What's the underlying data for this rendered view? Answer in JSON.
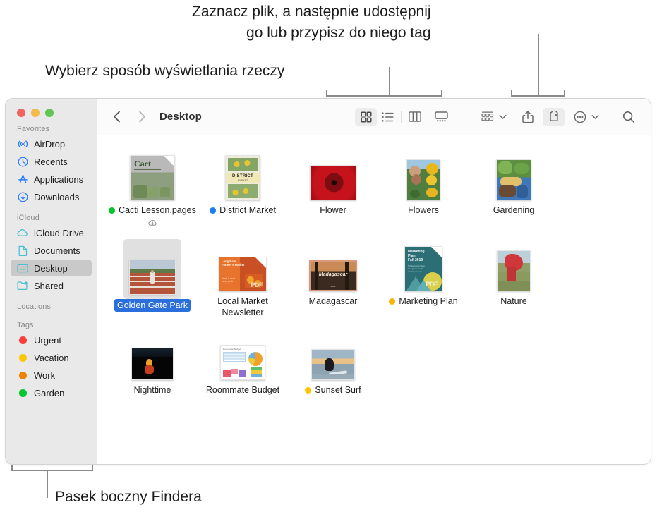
{
  "callouts": {
    "top": "Zaznacz plik, a następnie udostępnij\ngo lub przypisz do niego tag",
    "left": "Wybierz sposób wyświetlania rzeczy",
    "bottom": "Pasek boczny Findera"
  },
  "window": {
    "traffic_lights": [
      "close-red",
      "minimize-yellow",
      "zoom-green"
    ],
    "title": "Desktop"
  },
  "toolbar": {
    "back_icon": "chevron-left-icon",
    "forward_icon": "chevron-right-icon",
    "view_buttons": [
      {
        "name": "icon-view",
        "icon": "grid-icon",
        "active": true
      },
      {
        "name": "list-view",
        "icon": "list-icon",
        "active": false
      },
      {
        "name": "column-view",
        "icon": "columns-icon",
        "active": false
      },
      {
        "name": "gallery-view",
        "icon": "gallery-icon",
        "active": false
      }
    ],
    "group_by": {
      "name": "group-by-button",
      "icon": "group-icon",
      "chevron": "⌄"
    },
    "share": {
      "name": "share-button",
      "icon": "share-icon"
    },
    "tags": {
      "name": "tags-button",
      "icon": "tag-icon",
      "active": true
    },
    "more": {
      "name": "more-actions-button",
      "icon": "ellipsis-circle-icon",
      "chevron": "⌄"
    },
    "search": {
      "name": "search-button",
      "icon": "search-icon"
    }
  },
  "sidebar": {
    "sections": [
      {
        "label": "Favorites",
        "items": [
          {
            "label": "AirDrop",
            "icon": "airdrop-icon",
            "color": "#2c7cf6",
            "selected": false
          },
          {
            "label": "Recents",
            "icon": "clock-icon",
            "color": "#2c7cf6",
            "selected": false
          },
          {
            "label": "Applications",
            "icon": "appstore-a-icon",
            "color": "#2c7cf6",
            "selected": false
          },
          {
            "label": "Downloads",
            "icon": "download-icon",
            "color": "#2c7cf6",
            "selected": false
          }
        ]
      },
      {
        "label": "iCloud",
        "items": [
          {
            "label": "iCloud Drive",
            "icon": "cloud-icon",
            "color": "#4cc0d0",
            "selected": false
          },
          {
            "label": "Documents",
            "icon": "document-icon",
            "color": "#4cc0d0",
            "selected": false
          },
          {
            "label": "Desktop",
            "icon": "desktop-icon",
            "color": "#4cc0d0",
            "selected": true
          },
          {
            "label": "Shared",
            "icon": "shared-folder-icon",
            "color": "#4cc0d0",
            "selected": false
          }
        ]
      },
      {
        "label": "Locations",
        "items": []
      },
      {
        "label": "Tags",
        "items": [
          {
            "label": "Urgent",
            "icon": "tag-dot-icon",
            "color": "#fc3d39",
            "selected": false
          },
          {
            "label": "Vacation",
            "icon": "tag-dot-icon",
            "color": "#fcc700",
            "selected": false
          },
          {
            "label": "Work",
            "icon": "tag-dot-icon",
            "color": "#ef8200",
            "selected": false
          },
          {
            "label": "Garden",
            "icon": "tag-dot-icon",
            "color": "#00c631",
            "selected": false
          }
        ]
      }
    ]
  },
  "files": [
    {
      "name": "Cacti Lesson.pages",
      "kind": "pages-doc",
      "tag_color": "#00c631",
      "selected": false,
      "cloud": true
    },
    {
      "name": "District Market",
      "kind": "poster",
      "tag_color": "#1a7ef5",
      "selected": false,
      "cloud": false
    },
    {
      "name": "Flower",
      "kind": "photo-red",
      "tag_color": null,
      "selected": false,
      "cloud": false
    },
    {
      "name": "Flowers",
      "kind": "photo-sunflower",
      "tag_color": null,
      "selected": false,
      "cloud": false
    },
    {
      "name": "Gardening",
      "kind": "photo-garden",
      "tag_color": null,
      "selected": false,
      "cloud": false
    },
    {
      "name": "Golden Gate Park",
      "kind": "photo-track",
      "tag_color": null,
      "selected": true,
      "cloud": false
    },
    {
      "name": "Local Market Newsletter",
      "kind": "pdf-orange",
      "tag_color": null,
      "selected": false,
      "cloud": false
    },
    {
      "name": "Madagascar",
      "kind": "photo-madagascar",
      "tag_color": null,
      "selected": false,
      "cloud": false
    },
    {
      "name": "Marketing Plan",
      "kind": "pdf-teal",
      "tag_color": "#fcb400",
      "selected": false,
      "cloud": false
    },
    {
      "name": "Nature",
      "kind": "photo-nature",
      "tag_color": null,
      "selected": false,
      "cloud": false
    },
    {
      "name": "Nighttime",
      "kind": "photo-night",
      "tag_color": null,
      "selected": false,
      "cloud": false
    },
    {
      "name": "Roommate Budget",
      "kind": "numbers-doc",
      "tag_color": null,
      "selected": false,
      "cloud": false
    },
    {
      "name": "Sunset Surf",
      "kind": "photo-surf",
      "tag_color": "#fcc700",
      "selected": false,
      "cloud": false
    }
  ]
}
